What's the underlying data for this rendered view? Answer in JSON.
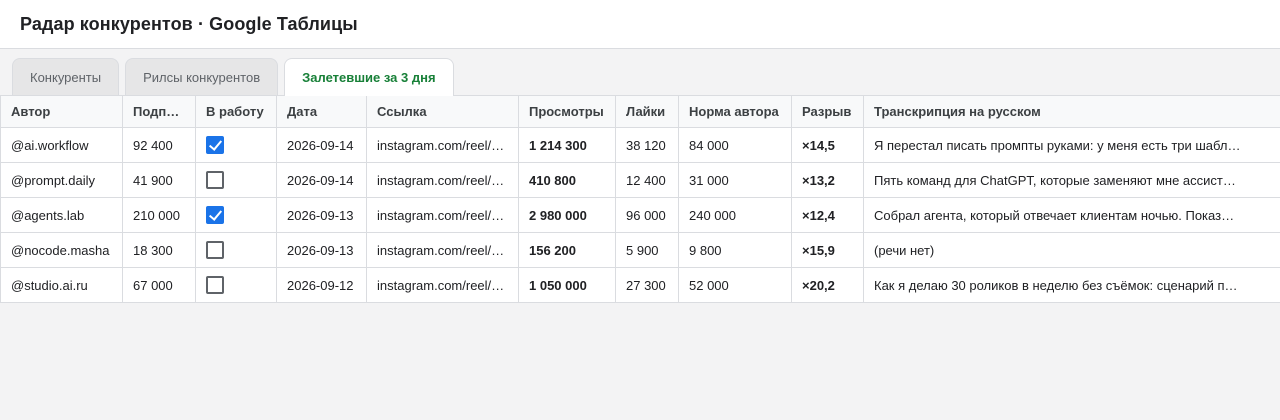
{
  "app": {
    "title": "Радар конкурентов · Google Таблицы"
  },
  "tabs": [
    {
      "label": "Конкуренты",
      "active": false
    },
    {
      "label": "Рилсы конкурентов",
      "active": false
    },
    {
      "label": "Залетевшие за 3 дня",
      "active": true
    }
  ],
  "table": {
    "headers": [
      "Автор",
      "Подписчики",
      "В работу",
      "Дата",
      "Ссылка",
      "Просмотры",
      "Лайки",
      "Норма автора",
      "Разрыв",
      "Транскрипция на русском"
    ],
    "rows": [
      {
        "author": "@ai.workflow",
        "subscribers": "92 400",
        "in_work": true,
        "date": "2026-09-14",
        "link": "instagram.com/reel/…",
        "views": "1 214 300",
        "likes": "38 120",
        "norm": "84 000",
        "gap": "×14,5",
        "transcript": "Я перестал писать промпты руками: у меня есть три шабл…"
      },
      {
        "author": "@prompt.daily",
        "subscribers": "41 900",
        "in_work": false,
        "date": "2026-09-14",
        "link": "instagram.com/reel/…",
        "views": "410 800",
        "likes": "12 400",
        "norm": "31 000",
        "gap": "×13,2",
        "transcript": "Пять команд для ChatGPT, которые заменяют мне ассист…"
      },
      {
        "author": "@agents.lab",
        "subscribers": "210 000",
        "in_work": true,
        "date": "2026-09-13",
        "link": "instagram.com/reel/…",
        "views": "2 980 000",
        "likes": "96 000",
        "norm": "240 000",
        "gap": "×12,4",
        "transcript": "Собрал агента, который отвечает клиентам ночью. Показ…"
      },
      {
        "author": "@nocode.masha",
        "subscribers": "18 300",
        "in_work": false,
        "date": "2026-09-13",
        "link": "instagram.com/reel/…",
        "views": "156 200",
        "likes": "5 900",
        "norm": "9 800",
        "gap": "×15,9",
        "transcript": "(речи нет)"
      },
      {
        "author": "@studio.ai.ru",
        "subscribers": "67 000",
        "in_work": false,
        "date": "2026-09-12",
        "link": "instagram.com/reel/…",
        "views": "1 050 000",
        "likes": "27 300",
        "norm": "52 000",
        "gap": "×20,2",
        "transcript": "Как я делаю 30 роликов в неделю без съёмок: сценарий п…"
      }
    ]
  },
  "colors": {
    "accent_tab": "#188038",
    "highlight_red": "#d93025",
    "checkbox_blue": "#1a73e8"
  }
}
